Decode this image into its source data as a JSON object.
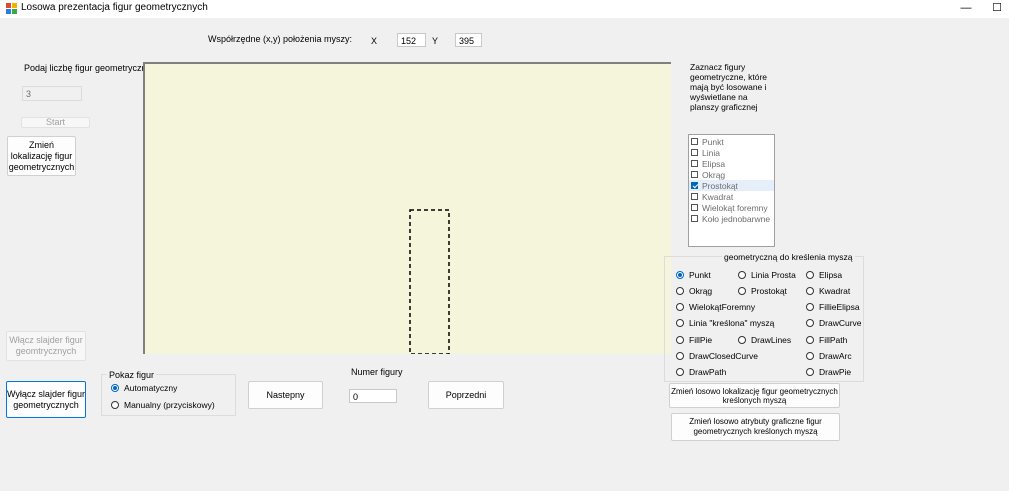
{
  "window": {
    "title": "Losowa prezentacja figur geometrycznych",
    "minimize_glyph": "—",
    "maximize_glyph": "☐"
  },
  "mouse": {
    "label": "Współrzędne (x,y) położenia myszy:",
    "x_label": "X",
    "x_value": "152",
    "y_label": "Y",
    "y_value": "395"
  },
  "left_panel": {
    "count_label": "Podaj liczbę figur geometrycznych",
    "count_value": "3",
    "start_label": "Start",
    "change_location_label": "Zmień lokalizację figur geometrycznych",
    "enable_slider_label": "Włącz slajder figur geomtrycznych",
    "disable_slider_label": "Wyłącz slajder figur geometrycznych"
  },
  "show_mode": {
    "legend": "Pokaz figur",
    "options": [
      "Automatyczny",
      "Manualny (przyciskowy)"
    ],
    "selected": 0
  },
  "nav": {
    "next_label": "Nastepny",
    "number_label": "Numer figury",
    "number_value": "0",
    "prev_label": "Poprzedni"
  },
  "shapes_panel": {
    "heading": "Zaznacz figury geometryczne, które mają być losowane i wyświetlane na planszy graficznej",
    "items": [
      {
        "label": "Punkt",
        "checked": false
      },
      {
        "label": "Linia",
        "checked": false
      },
      {
        "label": "Elipsa",
        "checked": false
      },
      {
        "label": "Okrąg",
        "checked": false
      },
      {
        "label": "Prostokąt",
        "checked": true
      },
      {
        "label": "Kwadrat",
        "checked": false
      },
      {
        "label": "Wielokąt foremny",
        "checked": false
      },
      {
        "label": "Koło jednobarwne",
        "checked": false
      }
    ]
  },
  "draw_group": {
    "legend": "geometryczną do kreślenia myszą",
    "selected": "Punkt",
    "col1": [
      "Punkt",
      "Okrąg",
      "WielokątForemny",
      "Linia \"kreślona\" myszą",
      "FillPie",
      "DrawClosedCurve",
      "DrawPath"
    ],
    "col2": [
      "Linia Prosta",
      "Prostokąt",
      "",
      "",
      "DrawLines",
      "",
      ""
    ],
    "col3": [
      "Elipsa",
      "Kwadrat",
      "FillieElipsa",
      "DrawCurve",
      "FillPath",
      "DrawArc",
      "DrawPie"
    ]
  },
  "bottom_right": {
    "random_location_label": "Zmień losowo lokalizację figur geometrycznych kreślonych myszą",
    "random_attributes_label": "Zmień losowo atrybuty graficzne figur geometrycznych kreślonych myszą"
  }
}
